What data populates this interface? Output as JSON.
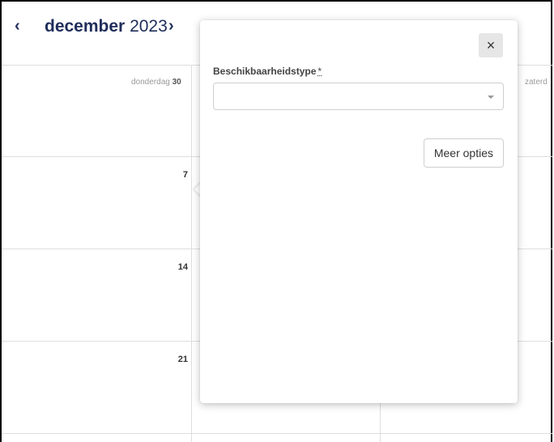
{
  "calendar": {
    "month": "december",
    "year": "2023",
    "prev_icon": "chevron-left-icon",
    "next_icon": "chevron-right-icon",
    "col1_header_day": "donderdag",
    "col1_header_num": "30",
    "col3_header_day": "zaterd",
    "rows": [
      {
        "date": "7"
      },
      {
        "date": "14"
      },
      {
        "date": "21"
      }
    ]
  },
  "popup": {
    "field_label": "Beschikbaarheidstype",
    "required_marker": "*",
    "select_value": "",
    "more_button": "Meer opties",
    "close_icon": "close-icon",
    "close_glyph": "×"
  },
  "colors": {
    "title": "#1f2d5a",
    "grid": "#dedede",
    "close_bg": "#e6e6e6"
  }
}
